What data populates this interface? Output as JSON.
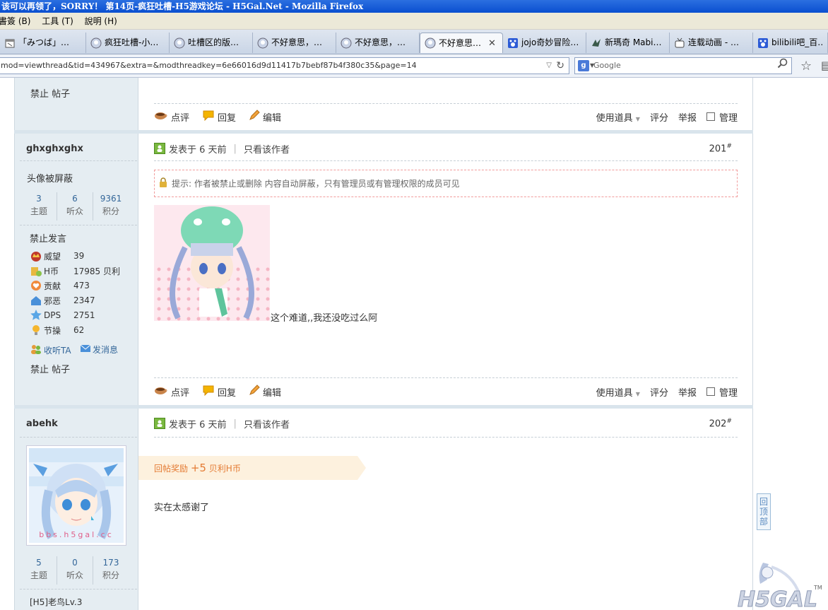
{
  "window": {
    "title": "该可以再领了，SORRY！ 第14页-疯狂吐槽-H5游戏论坛 - H5Gal.Net - Mozilla Firefox"
  },
  "menu": {
    "items": [
      "書簽 (B)",
      "工具 (T)",
      "說明 (H)"
    ]
  },
  "tabs": [
    {
      "label": "「みつば」…",
      "icon": "calendar-icon",
      "active": false
    },
    {
      "label": "疯狂吐槽-小…",
      "icon": "avatar-icon",
      "active": false
    },
    {
      "label": "吐槽区的版…",
      "icon": "avatar-icon",
      "active": false
    },
    {
      "label": "不好意思，…",
      "icon": "avatar-icon",
      "active": false
    },
    {
      "label": "不好意思，…",
      "icon": "avatar-icon",
      "active": false
    },
    {
      "label": "不好意思…",
      "icon": "avatar-icon",
      "active": true
    },
    {
      "label": "jojo奇妙冒险…",
      "icon": "paw-icon",
      "active": false
    },
    {
      "label": "新瑪奇 Mabi…",
      "icon": "dragon-icon",
      "active": false
    },
    {
      "label": "连载动画 - …",
      "icon": "tv-icon",
      "active": false
    },
    {
      "label": "bilibili吧_百…",
      "icon": "paw-icon",
      "active": false
    }
  ],
  "nav": {
    "url": "mod=viewthread&tid=434967&extra=&modthreadkey=6e66016d9d11417b7bebf87b4f380c35&page=14",
    "search_placeholder": "Google",
    "search_engine": "g"
  },
  "post_top": {
    "left_footer": "禁止 帖子"
  },
  "toolbar": {
    "comment": "点评",
    "reply": "回复",
    "edit": "编辑",
    "use_item": "使用道具",
    "rate": "评分",
    "report": "举报",
    "manage": "管理"
  },
  "post201": {
    "author": "ghxghxghx",
    "avatar_blocked": "头像被屏蔽",
    "stats": [
      {
        "num": "3",
        "label": "主题"
      },
      {
        "num": "6",
        "label": "听众"
      },
      {
        "num": "9361",
        "label": "积分"
      }
    ],
    "banned": "禁止发言",
    "attrs": [
      {
        "icon": "crown-icon",
        "name": "威望",
        "value": "39"
      },
      {
        "icon": "coin-icon",
        "name": "H币",
        "value": "17985 贝利"
      },
      {
        "icon": "heart-icon",
        "name": "贡献",
        "value": "473"
      },
      {
        "icon": "house-icon",
        "name": "邪恶",
        "value": "2347"
      },
      {
        "icon": "star-icon",
        "name": "DPS",
        "value": "2751"
      },
      {
        "icon": "bulb-icon",
        "name": "节操",
        "value": "62"
      }
    ],
    "follow": "收听TA",
    "message": "发消息",
    "footer": "禁止 帖子",
    "posted": "发表于 6 天前",
    "only_author": "只看该作者",
    "floor": "201",
    "floor_mark": "#",
    "notice": "提示: 作者被禁止或删除 内容自动屏蔽，只有管理员或有管理权限的成员可见",
    "message_text": "这个难道,,我还没吃过么阿"
  },
  "post202": {
    "author": "abehk",
    "avatar_watermark": "bbs.h5gal.cc",
    "stats": [
      {
        "num": "5",
        "label": "主题"
      },
      {
        "num": "0",
        "label": "听众"
      },
      {
        "num": "173",
        "label": "积分"
      }
    ],
    "rank": "[H5]老鸟Lv.3",
    "posted": "发表于 6 天前",
    "only_author": "只看该作者",
    "floor": "202",
    "floor_mark": "#",
    "reward_label": "回帖奖励",
    "reward_amount": "+5",
    "reward_unit": "贝利H币",
    "message_text": "实在太感谢了"
  },
  "back_to_top": "回顶部",
  "site_logo": {
    "text": "H5GAL",
    "tm": "TM"
  },
  "colors": {
    "titlebar": "#0a4fd0",
    "sidebar": "#e5edf2",
    "link": "#336699",
    "reward": "#e47b34",
    "notice_border": "#f19b9b"
  }
}
